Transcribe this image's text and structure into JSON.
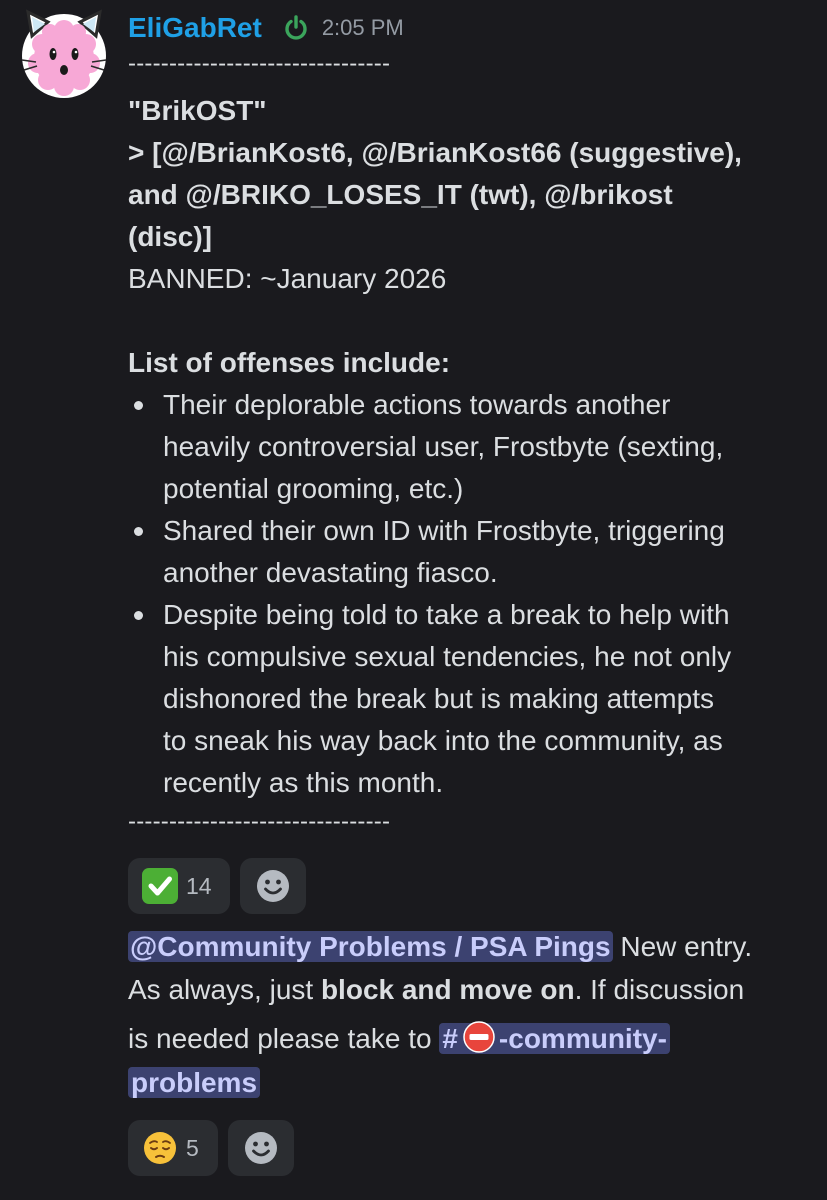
{
  "message": {
    "username": "EliGabRet",
    "timestamp": "2:05 PM",
    "divider": "--------------------------------",
    "title": "\"BrikOST\"",
    "aliases_line1": "> [@/BrianKost6, @/BrianKost66 (suggestive),",
    "aliases_line2": "and @/BRIKO_LOSES_IT (twt), @/brikost",
    "aliases_line3": "(disc)]",
    "banned": "BANNED: ~January 2026",
    "offenses_heading": "List of offenses include:",
    "offenses": [
      {
        "lines": [
          "Their deplorable actions towards another",
          "heavily controversial user, Frostbyte (sexting,",
          "potential grooming, etc.)"
        ]
      },
      {
        "lines": [
          "Shared their own ID with Frostbyte, triggering",
          "another devastating fiasco."
        ]
      },
      {
        "lines": [
          "Despite being told to take a break to help with",
          "his compulsive sexual tendencies, he not only",
          "dishonored the break but is making attempts",
          "to sneak his way back into the community, as",
          "recently as this month."
        ]
      }
    ],
    "reactions": [
      {
        "emoji": "white-check-mark",
        "count": "14"
      }
    ]
  },
  "followup": {
    "role_mention": "@Community Problems / PSA Pings",
    "text_after_mention": " New entry.",
    "line2_prefix": "As always, just ",
    "line2_bold": "block and move on",
    "line2_suffix": ". If discussion",
    "line3_prefix": "is needed please take to ",
    "channel_hash": "#",
    "channel_name_part1": "-community-",
    "channel_name_part2": "problems",
    "reactions": [
      {
        "emoji": "pensive-face",
        "count": "5"
      }
    ]
  },
  "colors": {
    "background": "#1a1a1e",
    "username": "#1fa0e6",
    "mention_bg": "#3c4270",
    "mention_text": "#c9cdfb",
    "online": "#3ba55c"
  }
}
